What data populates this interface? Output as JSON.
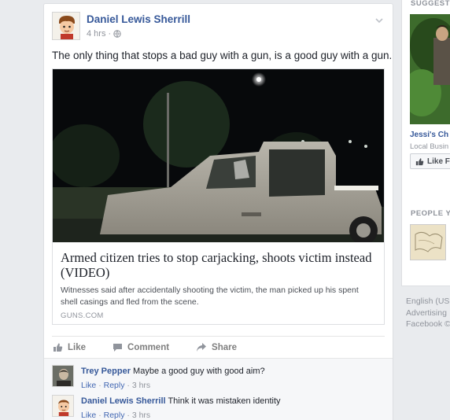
{
  "post": {
    "author": "Daniel Lewis Sherrill",
    "time": "4 hrs",
    "text": "The only thing that stops a bad guy with a gun, is a good guy with a gun.",
    "link": {
      "title": "Armed citizen tries to stop carjacking, shoots victim instead (VIDEO)",
      "description": "Witnesses said after accidentally shooting the victim, the man picked up his spent shell casings and fled from the scene.",
      "domain": "GUNS.COM"
    },
    "actions": {
      "like": "Like",
      "comment": "Comment",
      "share": "Share"
    }
  },
  "comments": [
    {
      "name": "Trey Pepper",
      "text": "Maybe a good guy with good aim?",
      "like": "Like",
      "reply": "Reply",
      "time": "3 hrs",
      "sep": "·"
    },
    {
      "name": "Daniel Lewis Sherrill",
      "text": "Think it was mistaken identity",
      "like": "Like",
      "reply": "Reply",
      "time": "3 hrs",
      "sep": "·"
    }
  ],
  "sidebar": {
    "suggested_title": "SUGGESTI",
    "page_name": "Jessi's Ch",
    "page_category": "Local Busin",
    "like_button": "Like F",
    "pymk_title": "PEOPLE Y"
  },
  "footer": {
    "language": "English (US",
    "advertising": "Advertising",
    "facebook": "Facebook ©"
  },
  "colors": {
    "link_blue": "#365899",
    "muted": "#90949c",
    "background": "#e9ebee"
  },
  "icons": [
    "globe-icon",
    "chevron-down-icon",
    "thumbs-up-icon",
    "comment-icon",
    "share-icon"
  ]
}
